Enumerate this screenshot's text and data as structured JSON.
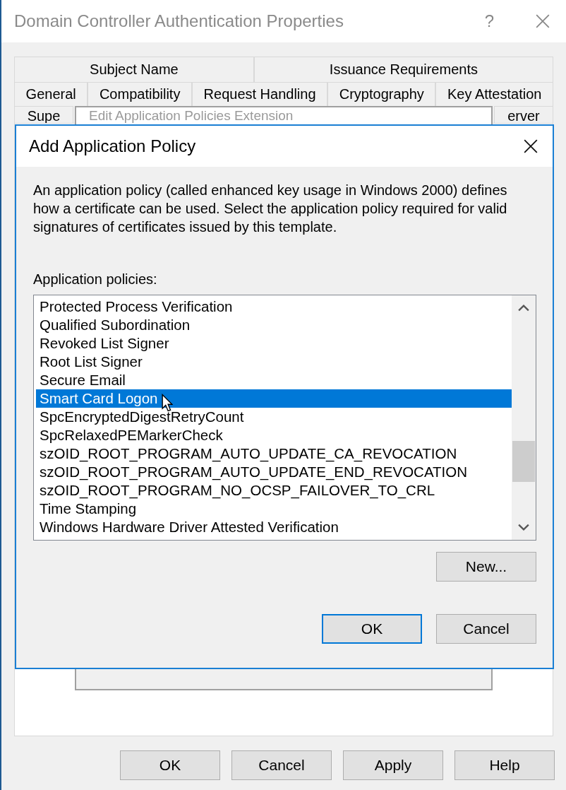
{
  "window": {
    "title": "Domain Controller Authentication Properties",
    "help": "?",
    "tab_rows": [
      [
        "Subject Name",
        "Issuance Requirements"
      ],
      [
        "General",
        "Compatibility",
        "Request Handling",
        "Cryptography",
        "Key Attestation"
      ],
      [
        "Supe",
        "erver"
      ]
    ],
    "buttons": [
      "OK",
      "Cancel",
      "Apply",
      "Help"
    ]
  },
  "edit_dialog": {
    "title": "Edit Application Policies Extension"
  },
  "add_dialog": {
    "title": "Add Application Policy",
    "description": "An application policy (called enhanced key usage in Windows 2000) defines how a certificate can be used. Select the application policy required for valid signatures of certificates issued by this template.",
    "list_label": "Application policies:",
    "policies": [
      {
        "label": "Protected Process Verification",
        "selected": false
      },
      {
        "label": "Qualified Subordination",
        "selected": false
      },
      {
        "label": "Revoked List Signer",
        "selected": false
      },
      {
        "label": "Root List Signer",
        "selected": false
      },
      {
        "label": "Secure Email",
        "selected": false
      },
      {
        "label": "Smart Card Logon",
        "selected": true
      },
      {
        "label": "SpcEncryptedDigestRetryCount",
        "selected": false
      },
      {
        "label": "SpcRelaxedPEMarkerCheck",
        "selected": false
      },
      {
        "label": "szOID_ROOT_PROGRAM_AUTO_UPDATE_CA_REVOCATION",
        "selected": false
      },
      {
        "label": "szOID_ROOT_PROGRAM_AUTO_UPDATE_END_REVOCATION",
        "selected": false
      },
      {
        "label": "szOID_ROOT_PROGRAM_NO_OCSP_FAILOVER_TO_CRL",
        "selected": false
      },
      {
        "label": "Time Stamping",
        "selected": false
      },
      {
        "label": "Windows Hardware Driver Attested Verification",
        "selected": false
      }
    ],
    "new_button": "New...",
    "buttons": [
      {
        "label": "OK",
        "default": true
      },
      {
        "label": "Cancel",
        "default": false
      }
    ]
  }
}
